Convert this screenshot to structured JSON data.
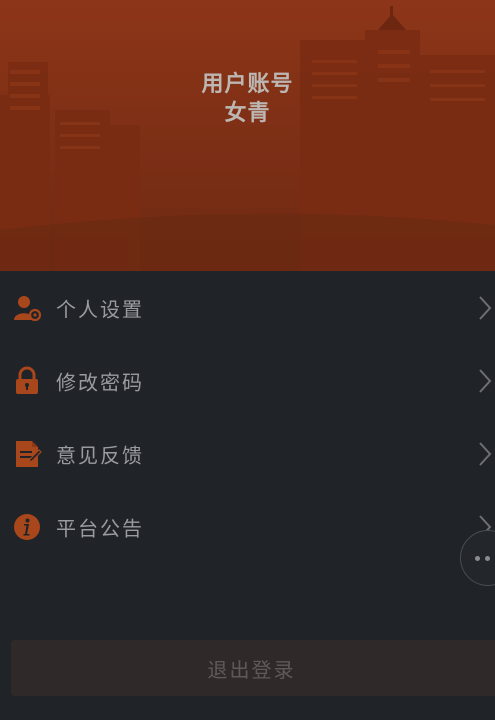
{
  "header": {
    "account_label": "用户账号",
    "account_name": "女青"
  },
  "menu": {
    "items": [
      {
        "label": "个人设置",
        "icon": "user-settings-icon"
      },
      {
        "label": "修改密码",
        "icon": "lock-icon"
      },
      {
        "label": "意见反馈",
        "icon": "feedback-document-icon"
      },
      {
        "label": "平台公告",
        "icon": "info-icon"
      }
    ]
  },
  "logout": {
    "label": "退出登录"
  },
  "colors": {
    "header_bg": "#8d3518",
    "page_bg": "#202328",
    "icon_accent": "#a8461c",
    "text": "#9a9ba0"
  }
}
